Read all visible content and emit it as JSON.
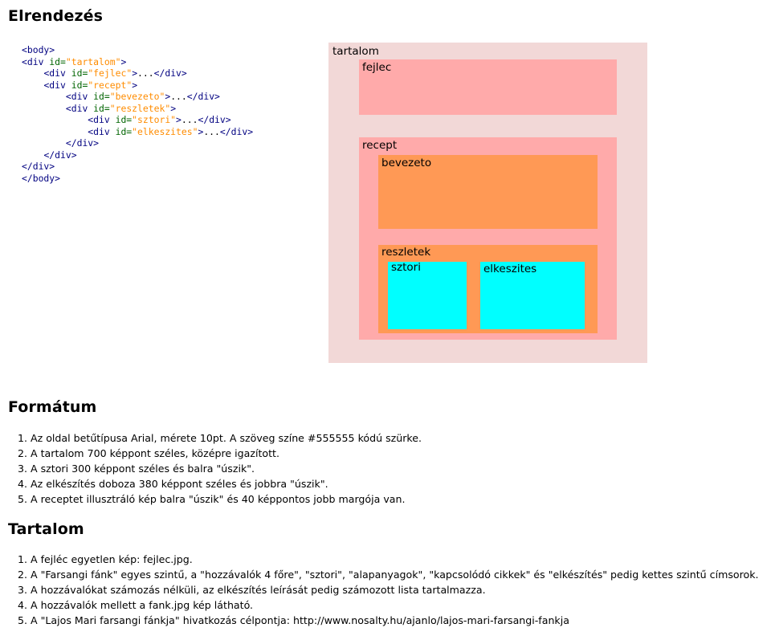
{
  "headings": {
    "layout": "Elrendezés",
    "format": "Formátum",
    "content": "Tartalom"
  },
  "code_lines": [
    [
      {
        "c": "t",
        "s": "<body>"
      }
    ],
    [
      {
        "c": "t",
        "s": "<div "
      },
      {
        "c": "a",
        "s": "id="
      },
      {
        "c": "v",
        "s": "\"tartalom\""
      },
      {
        "c": "t",
        "s": ">"
      }
    ],
    [
      {
        "c": "x",
        "s": "    "
      },
      {
        "c": "t",
        "s": "<div "
      },
      {
        "c": "a",
        "s": "id="
      },
      {
        "c": "v",
        "s": "\"fejlec\""
      },
      {
        "c": "t",
        "s": ">"
      },
      {
        "c": "x",
        "s": "..."
      },
      {
        "c": "t",
        "s": "</div>"
      }
    ],
    [
      {
        "c": "x",
        "s": "    "
      },
      {
        "c": "t",
        "s": "<div "
      },
      {
        "c": "a",
        "s": "id="
      },
      {
        "c": "v",
        "s": "\"recept\""
      },
      {
        "c": "t",
        "s": ">"
      }
    ],
    [
      {
        "c": "x",
        "s": "        "
      },
      {
        "c": "t",
        "s": "<div "
      },
      {
        "c": "a",
        "s": "id="
      },
      {
        "c": "v",
        "s": "\"bevezeto\""
      },
      {
        "c": "t",
        "s": ">"
      },
      {
        "c": "x",
        "s": "..."
      },
      {
        "c": "t",
        "s": "</div>"
      }
    ],
    [
      {
        "c": "x",
        "s": "        "
      },
      {
        "c": "t",
        "s": "<div "
      },
      {
        "c": "a",
        "s": "id="
      },
      {
        "c": "v",
        "s": "\"reszletek\""
      },
      {
        "c": "t",
        "s": ">"
      }
    ],
    [
      {
        "c": "x",
        "s": "            "
      },
      {
        "c": "t",
        "s": "<div "
      },
      {
        "c": "a",
        "s": "id="
      },
      {
        "c": "v",
        "s": "\"sztori\""
      },
      {
        "c": "t",
        "s": ">"
      },
      {
        "c": "x",
        "s": "..."
      },
      {
        "c": "t",
        "s": "</div>"
      }
    ],
    [
      {
        "c": "x",
        "s": "            "
      },
      {
        "c": "t",
        "s": "<div "
      },
      {
        "c": "a",
        "s": "id="
      },
      {
        "c": "v",
        "s": "\"elkeszites\""
      },
      {
        "c": "t",
        "s": ">"
      },
      {
        "c": "x",
        "s": "..."
      },
      {
        "c": "t",
        "s": "</div>"
      }
    ],
    [
      {
        "c": "x",
        "s": "        "
      },
      {
        "c": "t",
        "s": "</div>"
      }
    ],
    [
      {
        "c": "x",
        "s": "    "
      },
      {
        "c": "t",
        "s": "</div>"
      }
    ],
    [
      {
        "c": "t",
        "s": "</div>"
      }
    ],
    [
      {
        "c": "t",
        "s": "</body>"
      }
    ]
  ],
  "diagram": {
    "tartalom": "tartalom",
    "fejlec": "fejlec",
    "recept": "recept",
    "bevezeto": "bevezeto",
    "reszletek": "reszletek",
    "sztori": "sztori",
    "elkeszites": "elkeszites",
    "colors": {
      "tartalom": "#f2d8d7",
      "fejlec_recept": "#ffaaaa",
      "bevezeto_reszletek": "#ff9955",
      "sztori_elkeszites": "#00ffff"
    }
  },
  "format_items": [
    "Az oldal betűtípusa Arial, mérete 10pt. A szöveg színe #555555 kódú szürke.",
    "A tartalom 700 képpont széles, középre igazított.",
    "A sztori 300 képpont széles és balra \"úszik\".",
    "Az elkészítés doboza 380 képpont széles és jobbra \"úszik\".",
    "A receptet illusztráló kép balra \"úszik\" és 40 képpontos jobb margója van."
  ],
  "content_items": [
    "A fejléc egyetlen kép: fejlec.jpg.",
    "A \"Farsangi fánk\" egyes szintű, a \"hozzávalók 4 főre\", \"sztori\", \"alapanyagok\", \"kapcsolódó cikkek\" és \"elkészítés\" pedig kettes szintű címsorok.",
    "A hozzávalókat számozás nélküli, az elkészítés leírását pedig számozott lista tartalmazza.",
    "A hozzávalók mellett a fank.jpg kép látható.",
    "A \"Lajos Mari farsangi fánkja\" hivatkozás célpontja: http://www.nosalty.hu/ajanlo/lajos-mari-farsangi-fankja"
  ]
}
